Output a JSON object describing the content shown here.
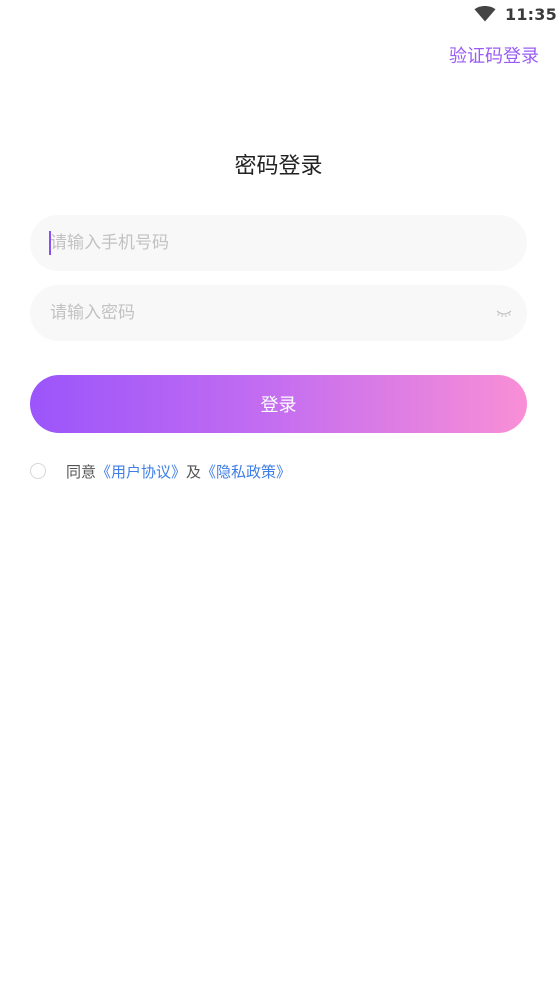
{
  "status_bar": {
    "time": "11:35",
    "wifi_icon": "wifi-icon"
  },
  "header": {
    "switch_link": "验证码登录"
  },
  "title": "密码登录",
  "form": {
    "phone_placeholder": "请输入手机号码",
    "password_placeholder": "请输入密码",
    "eye_icon": "eye-closed-icon"
  },
  "login_button": "登录",
  "agreement": {
    "prefix": "同意",
    "user_agreement": "《用户协议》",
    "conjunction": "及",
    "privacy_policy": "《隐私政策》"
  },
  "colors": {
    "accent": "#9b5cf5",
    "gradient_start": "#9b55fb",
    "gradient_end": "#f98fd6",
    "link": "#3f7ee6"
  }
}
